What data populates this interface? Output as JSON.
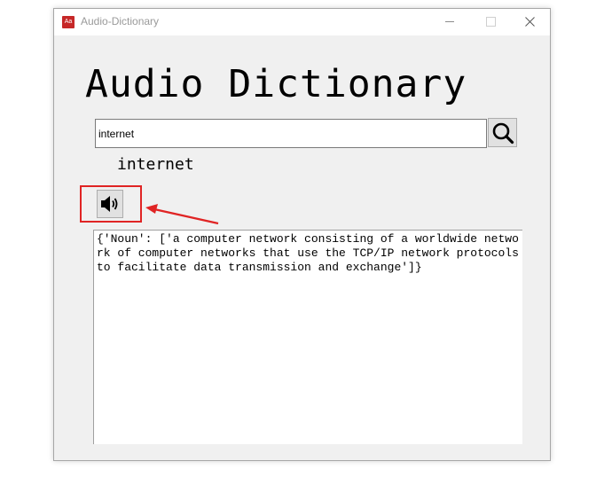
{
  "window": {
    "title": "Audio-Dictionary",
    "icon_label": "Aa"
  },
  "app": {
    "heading": "Audio Dictionary"
  },
  "search": {
    "value": "internet",
    "button_icon": "magnifier-icon"
  },
  "result": {
    "word": "internet",
    "speaker_icon": "speaker-icon",
    "definition": "{'Noun': ['a computer network consisting of a worldwide network of computer networks that use the TCP/IP network protocols to facilitate data transmission and exchange']}"
  },
  "colors": {
    "annotation": "#e02424",
    "window_bg": "#f0f0f0"
  }
}
